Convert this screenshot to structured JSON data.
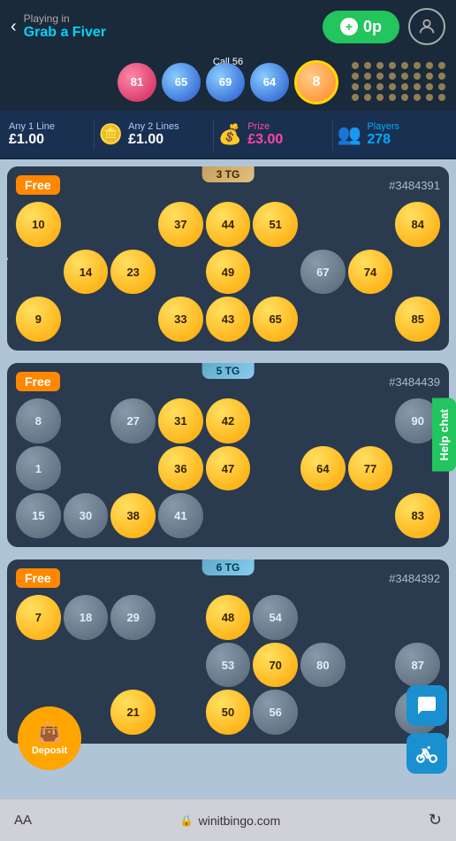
{
  "header": {
    "back_label": "‹",
    "playing_in": "Playing in",
    "game_name": "Grab a Fiver",
    "plus_icon": "+",
    "balance": "0p",
    "avatar_icon": "👤"
  },
  "call_bar": {
    "call_label": "Call 56",
    "balls": [
      {
        "number": "81",
        "color": "pink"
      },
      {
        "number": "65",
        "color": "blue"
      },
      {
        "number": "69",
        "color": "blue"
      },
      {
        "number": "64",
        "color": "blue"
      },
      {
        "number": "8",
        "color": "pink",
        "last": true
      }
    ]
  },
  "stats": {
    "any1_label": "Any 1 Line",
    "any1_value": "£1.00",
    "any2_label": "Any 2 Lines",
    "any2_value": "£1.00",
    "prize_label": "Prize",
    "prize_value": "£3.00",
    "players_label": "Players",
    "players_value": "278"
  },
  "cards": [
    {
      "id": "#3484391",
      "tg": "3 TG",
      "tg_color": "gold",
      "free": true,
      "rows": [
        [
          "10",
          "",
          "",
          "37",
          "44",
          "51",
          "",
          "",
          "84"
        ],
        [
          "",
          "14",
          "23",
          "",
          "49",
          "",
          "67",
          "74",
          ""
        ],
        [
          "9",
          "",
          "",
          "33",
          "43",
          "65",
          "",
          "",
          "85"
        ]
      ],
      "called": [
        "10",
        "37",
        "44",
        "51",
        "84",
        "14",
        "23",
        "49",
        "67",
        "74",
        "9",
        "33",
        "43",
        "65",
        "85"
      ]
    },
    {
      "id": "#3484439",
      "tg": "5 TG",
      "tg_color": "blue",
      "free": true,
      "rows": [
        [
          "8",
          "",
          "27",
          "31",
          "42",
          "",
          "",
          "",
          "90"
        ],
        [
          "1",
          "",
          "",
          "36",
          "47",
          "",
          "64",
          "77",
          ""
        ],
        [
          "15",
          "30",
          "38",
          "41",
          "",
          "",
          "",
          "",
          "83"
        ]
      ],
      "called": [
        "31",
        "42",
        "36",
        "47",
        "64",
        "77",
        "38",
        "83"
      ]
    },
    {
      "id": "#3484392",
      "tg": "6 TG",
      "tg_color": "blue",
      "free": true,
      "rows": [
        [
          "7",
          "18",
          "29",
          "",
          "48",
          "54",
          "",
          "",
          ""
        ],
        [
          "",
          "",
          "",
          "",
          "53",
          "70",
          "80",
          "",
          "87"
        ],
        [
          "",
          "",
          "21",
          "",
          "50",
          "56",
          "",
          "",
          "8"
        ]
      ],
      "called": [
        "7",
        "48",
        "70",
        "80",
        "21",
        "50"
      ]
    }
  ],
  "help_chat": "Help chat",
  "deposit_label": "Deposit",
  "browser": {
    "aa": "AA",
    "url": "winitbingo.com",
    "lock_icon": "🔒",
    "refresh_icon": "↻"
  }
}
